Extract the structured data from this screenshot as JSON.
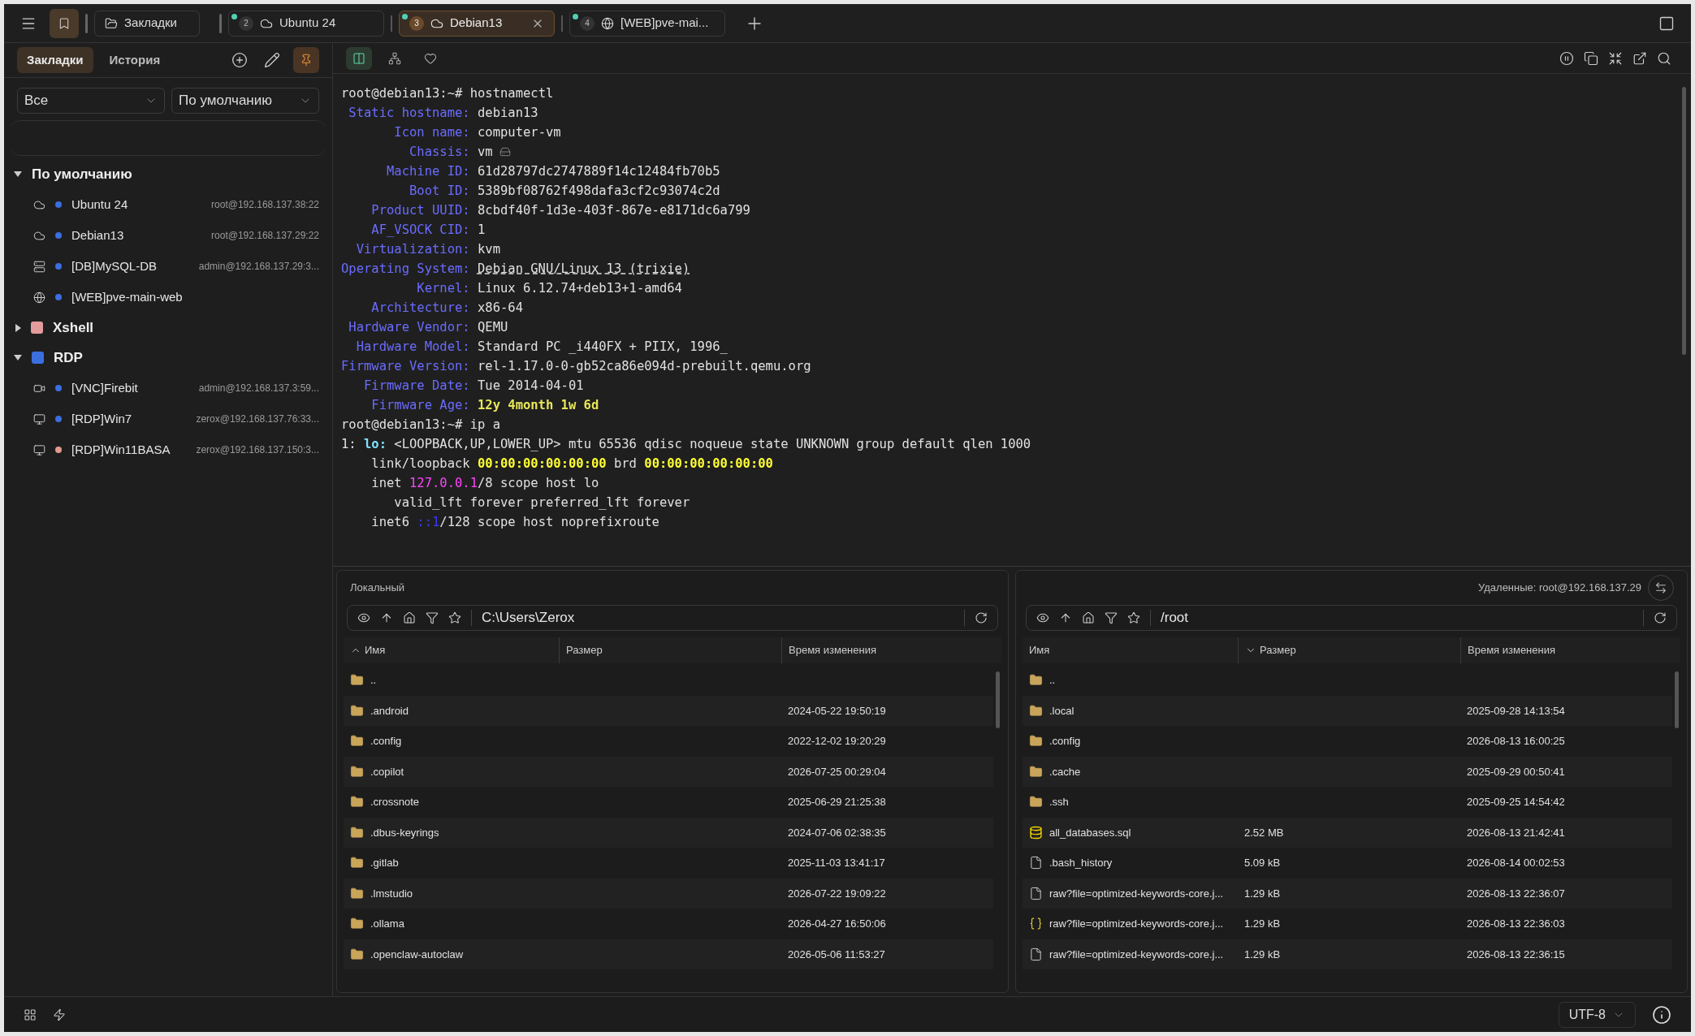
{
  "top_bar": {
    "bookmark_button_selected": true,
    "bookmarks_tab": {
      "label": "Закладки"
    },
    "tabs": [
      {
        "number": "2",
        "label": "Ubuntu 24",
        "kind": "ssh",
        "connected": true,
        "selected": false
      },
      {
        "number": "3",
        "label": "Debian13",
        "kind": "ssh",
        "connected": true,
        "selected": true
      },
      {
        "number": "4",
        "label": "[WEB]pve-mai...",
        "kind": "web",
        "connected": true,
        "selected": false
      }
    ]
  },
  "sidebar": {
    "tabs": [
      {
        "label": "Закладки",
        "selected": true
      },
      {
        "label": "История",
        "selected": false
      }
    ],
    "pin_selected": true,
    "filters": [
      {
        "value": "Все"
      },
      {
        "value": "По умолчанию"
      }
    ],
    "groups": [
      {
        "label": "По умолчанию",
        "expanded": true,
        "items": [
          {
            "kind": "ssh",
            "name": "Ubuntu 24",
            "address": "root@192.168.137.38:22",
            "color": "#3b6fe0"
          },
          {
            "kind": "ssh",
            "name": "Debian13",
            "address": "root@192.168.137.29:22",
            "color": "#3b6fe0"
          },
          {
            "kind": "database",
            "name": "[DB]MySQL-DB",
            "address": "admin@192.168.137.29:3...",
            "color": "#3b6fe0"
          },
          {
            "kind": "web",
            "name": "[WEB]pve-main-web",
            "color": "#3b6fe0"
          }
        ]
      },
      {
        "label": "Xshell",
        "expanded": false,
        "color": "#e49b9b"
      },
      {
        "label": "RDP",
        "expanded": true,
        "color": "#3b6fe0",
        "items": [
          {
            "kind": "vnc",
            "name": "[VNC]Firebit",
            "address": "admin@192.168.137.3:59...",
            "color": "#3b6fe0"
          },
          {
            "kind": "rdp",
            "name": "[RDP]Win7",
            "address": "zerox@192.168.137.76:33...",
            "color": "#3b6fe0"
          },
          {
            "kind": "rdp",
            "name": "[RDP]Win11BASA",
            "address": "zerox@192.168.137.150:3...",
            "color": "#e49b8b"
          }
        ]
      }
    ]
  },
  "terminal": {
    "toolbar": [
      {
        "kind": "split",
        "selected": true
      },
      {
        "kind": "tree",
        "selected": false
      },
      {
        "kind": "heart",
        "selected": false
      }
    ],
    "lines": [
      [
        {
          "kind": "plain",
          "text": "root@debian13:~# hostnamectl"
        }
      ],
      [
        {
          "kind": "key",
          "text": " Static hostname:"
        },
        {
          "kind": "plain",
          "text": " debian13"
        }
      ],
      [
        {
          "kind": "key",
          "text": "       Icon name:"
        },
        {
          "kind": "plain",
          "text": " computer-vm"
        }
      ],
      [
        {
          "kind": "key",
          "text": "         Chassis:"
        },
        {
          "kind": "plain",
          "text": " vm"
        },
        {
          "kind": "icon"
        }
      ],
      [
        {
          "kind": "key",
          "text": "      Machine ID:"
        },
        {
          "kind": "plain",
          "text": " 61d28797dc2747889f14c12484fb70b5"
        }
      ],
      [
        {
          "kind": "key",
          "text": "         Boot ID:"
        },
        {
          "kind": "plain",
          "text": " 5389bf08762f498dafa3cf2c93074c2d"
        }
      ],
      [
        {
          "kind": "key",
          "text": "    Product UUID:"
        },
        {
          "kind": "plain",
          "text": " 8cbdf40f-1d3e-403f-867e-e8171dc6a799"
        }
      ],
      [
        {
          "kind": "key",
          "text": "    AF_VSOCK CID:"
        },
        {
          "kind": "plain",
          "text": " 1"
        }
      ],
      [
        {
          "kind": "key",
          "text": "  Virtualization:"
        },
        {
          "kind": "plain",
          "text": " kvm"
        }
      ],
      [
        {
          "kind": "key",
          "text": "Operating System:"
        },
        {
          "kind": "underline",
          "spaced": true,
          "text": "Debian GNU/Linux 13 (trixie)"
        }
      ],
      [
        {
          "kind": "key",
          "text": "          Kernel:"
        },
        {
          "kind": "plain",
          "text": " Linux 6.12.74+deb13+1-amd64"
        }
      ],
      [
        {
          "kind": "key",
          "text": "    Architecture:"
        },
        {
          "kind": "plain",
          "text": " x86-64"
        }
      ],
      [
        {
          "kind": "key",
          "text": " Hardware Vendor:"
        },
        {
          "kind": "plain",
          "text": " QEMU"
        }
      ],
      [
        {
          "kind": "key",
          "text": "  Hardware Model:"
        },
        {
          "kind": "plain",
          "text": " Standard PC _i440FX + PIIX, 1996_"
        }
      ],
      [
        {
          "kind": "key",
          "text": "Firmware Version:"
        },
        {
          "kind": "plain",
          "text": " rel-1.17.0-0-gb52ca86e094d-prebuilt.qemu.org"
        }
      ],
      [
        {
          "kind": "key",
          "text": "   Firmware Date:"
        },
        {
          "kind": "plain",
          "text": " Tue 2014-04-01"
        }
      ],
      [
        {
          "kind": "key",
          "text": "    Firmware Age:"
        },
        {
          "kind": "yellow",
          "spaced": true,
          "text": "12y 4month 1w 6d"
        }
      ],
      [
        {
          "kind": "plain",
          "text": "root@debian13:~# ip a"
        }
      ],
      [
        {
          "kind": "plain",
          "text": "1: "
        },
        {
          "kind": "cyan",
          "text": "lo:"
        },
        {
          "kind": "plain",
          "text": " <LOOPBACK,UP,LOWER_UP> mtu 65536 qdisc noqueue state UNKNOWN group default qlen 1000"
        }
      ],
      [
        {
          "kind": "plain",
          "text": "    link/loopback "
        },
        {
          "kind": "bright_yellow",
          "text": "00:00:00:00:00:00"
        },
        {
          "kind": "plain",
          "text": " brd "
        },
        {
          "kind": "bright_yellow",
          "text": "00:00:00:00:00:00"
        }
      ],
      [
        {
          "kind": "plain",
          "text": "    inet "
        },
        {
          "kind": "magenta",
          "text": "127.0.0.1"
        },
        {
          "kind": "plain",
          "text": "/8 scope host lo"
        }
      ],
      [
        {
          "kind": "plain",
          "text": "       valid_lft forever preferred_lft forever"
        }
      ],
      [
        {
          "kind": "plain",
          "text": "    inet6 "
        },
        {
          "kind": "blue",
          "text": "::1"
        },
        {
          "kind": "plain",
          "text": "/128 scope host noprefixroute"
        }
      ]
    ]
  },
  "local_pane": {
    "title": "Локальный",
    "path": "C:\\Users\\Zerox",
    "columns": [
      {
        "label": "Имя",
        "sorted": true,
        "ascending": true
      },
      {
        "label": "Размер",
        "sorted": false
      },
      {
        "label": "Время изменения",
        "sorted": false
      }
    ],
    "rows": [
      {
        "kind": "folder",
        "name": ".."
      },
      {
        "kind": "folder",
        "name": ".android",
        "modified": "2024-05-22 19:50:19"
      },
      {
        "kind": "folder",
        "name": ".config",
        "modified": "2022-12-02 19:20:29"
      },
      {
        "kind": "folder",
        "name": ".copilot",
        "modified": "2026-07-25 00:29:04"
      },
      {
        "kind": "folder",
        "name": ".crossnote",
        "modified": "2025-06-29 21:25:38"
      },
      {
        "kind": "folder",
        "name": ".dbus-keyrings",
        "modified": "2024-07-06 02:38:35"
      },
      {
        "kind": "folder",
        "name": ".gitlab",
        "modified": "2025-11-03 13:41:17"
      },
      {
        "kind": "folder",
        "name": ".lmstudio",
        "modified": "2026-07-22 19:09:22"
      },
      {
        "kind": "folder",
        "name": ".ollama",
        "modified": "2026-04-27 16:50:06"
      },
      {
        "kind": "folder",
        "name": ".openclaw-autoclaw",
        "modified": "2026-05-06 11:53:27"
      }
    ]
  },
  "remote_pane": {
    "title": "Удаленные: root@192.168.137.29",
    "path": "/root",
    "columns": [
      {
        "label": "Имя",
        "sorted": false
      },
      {
        "label": "Размер",
        "sorted": true,
        "ascending": false
      },
      {
        "label": "Время изменения",
        "sorted": false
      }
    ],
    "rows": [
      {
        "kind": "folder",
        "name": ".."
      },
      {
        "kind": "folder",
        "name": ".local",
        "modified": "2025-09-28 14:13:54"
      },
      {
        "kind": "folder",
        "name": ".config",
        "modified": "2026-08-13 16:00:25"
      },
      {
        "kind": "folder",
        "name": ".cache",
        "modified": "2025-09-29 00:50:41"
      },
      {
        "kind": "folder",
        "name": ".ssh",
        "modified": "2025-09-25 14:54:42"
      },
      {
        "kind": "database",
        "name": "all_databases.sql",
        "size": "2.52 MB",
        "modified": "2026-08-13 21:42:41"
      },
      {
        "kind": "file",
        "name": ".bash_history",
        "size": "5.09 kB",
        "modified": "2026-08-14 00:02:53"
      },
      {
        "kind": "file",
        "name": "raw?file=optimized-keywords-core.j...",
        "size": "1.29 kB",
        "modified": "2026-08-13 22:36:07"
      },
      {
        "kind": "json",
        "name": "raw?file=optimized-keywords-core.j...",
        "size": "1.29 kB",
        "modified": "2026-08-13 22:36:03"
      },
      {
        "kind": "file",
        "name": "raw?file=optimized-keywords-core.j...",
        "size": "1.29 kB",
        "modified": "2026-08-13 22:36:15"
      }
    ]
  },
  "status_bar": {
    "encoding": "UTF-8"
  }
}
